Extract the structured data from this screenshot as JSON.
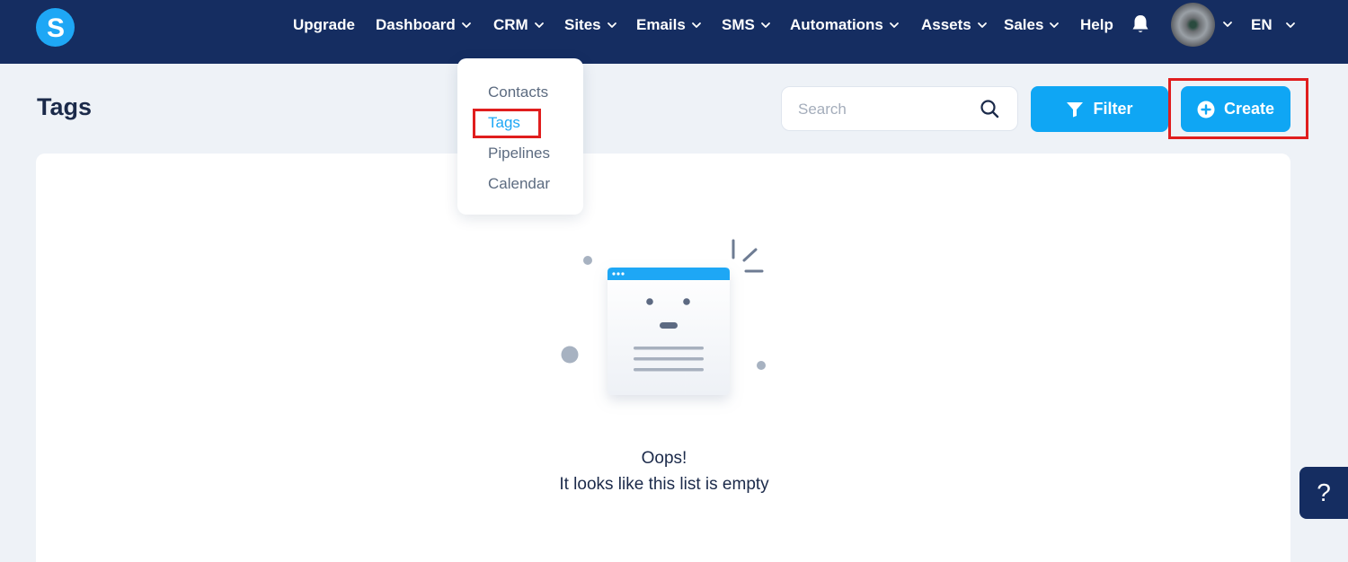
{
  "nav": {
    "logo_letter": "S",
    "items": [
      {
        "label": "Upgrade",
        "dropdown": false
      },
      {
        "label": "Dashboard",
        "dropdown": true
      },
      {
        "label": "CRM",
        "dropdown": true
      },
      {
        "label": "Sites",
        "dropdown": true
      },
      {
        "label": "Emails",
        "dropdown": true
      },
      {
        "label": "SMS",
        "dropdown": true
      },
      {
        "label": "Automations",
        "dropdown": true
      },
      {
        "label": "Assets",
        "dropdown": true
      },
      {
        "label": "Sales",
        "dropdown": true
      },
      {
        "label": "Help",
        "dropdown": false
      }
    ],
    "language": "EN"
  },
  "crm_menu": {
    "items": [
      {
        "label": "Contacts",
        "active": false
      },
      {
        "label": "Tags",
        "active": true
      },
      {
        "label": "Pipelines",
        "active": false
      },
      {
        "label": "Calendar",
        "active": false
      }
    ]
  },
  "page": {
    "title": "Tags",
    "search_placeholder": "Search",
    "search_value": "",
    "filter_label": "Filter",
    "create_label": "Create"
  },
  "empty_state": {
    "title": "Oops!",
    "subtitle": "It looks like this list is empty"
  },
  "help_tab": {
    "label": "?"
  },
  "colors": {
    "nav_bg": "#152d61",
    "accent": "#0fa6f4",
    "highlight": "#e01e1e",
    "page_bg": "#eef2f7"
  }
}
